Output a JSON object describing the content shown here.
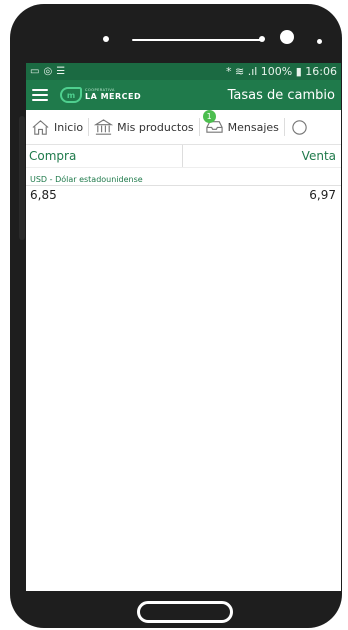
{
  "status_bar": {
    "left_icons": [
      "image-icon",
      "whatsapp-icon",
      "menu-icon"
    ],
    "right_text": "* ≋ .ıl 100% ▮ 16:06"
  },
  "app_bar": {
    "logo_top": "COOPERATIVA",
    "logo_main": "LA MERCED",
    "title": "Tasas de cambio"
  },
  "nav": {
    "home": "Inicio",
    "products": "Mis productos",
    "messages": "Mensajes",
    "messages_badge": "1"
  },
  "table": {
    "col_buy": "Compra",
    "col_sell": "Venta",
    "rows": [
      {
        "currency": "USD - Dólar estadounidense",
        "buy": "6,85",
        "sell": "6,97"
      }
    ]
  },
  "colors": {
    "status_bar": "#1b6a42",
    "app_bar": "#1f7a4b",
    "accent": "#4fd08f"
  }
}
